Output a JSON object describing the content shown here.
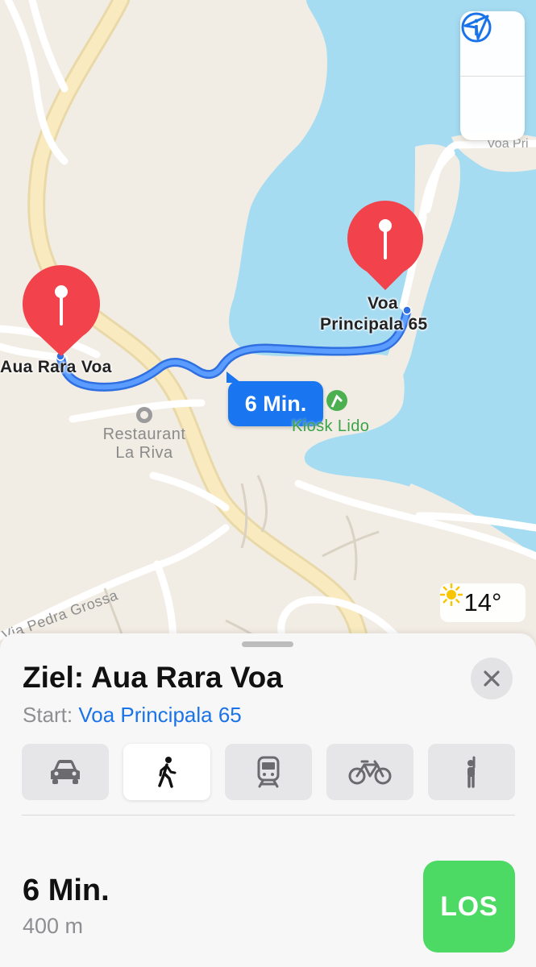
{
  "map": {
    "destination_label": "Aua Rara Voa",
    "start_label_line1": "Voa",
    "start_label_line2": "Principala 65",
    "route_duration": "6 Min.",
    "poi_restaurant_line1": "Restaurant",
    "poi_restaurant_line2": "La Riva",
    "poi_kiosk": "Kiosk Lido",
    "street_pedra_grossa": "Via Pedra Grossa",
    "street_voa_pri": "Voa Pri",
    "weather_temp": "14°",
    "colors": {
      "water": "#a6dcf2",
      "land": "#f2ede4",
      "route": "#3b82f6",
      "pin": "#f2424b",
      "main_road": "#f7e3a8"
    }
  },
  "controls": {
    "info_icon": "info-icon",
    "location_icon": "location-arrow-icon"
  },
  "sheet": {
    "title": "Ziel: Aua Rara Voa",
    "start_label": "Start:",
    "start_value": "Voa Principala 65",
    "modes": [
      {
        "name": "car",
        "icon": "car-icon",
        "active": false
      },
      {
        "name": "walk",
        "icon": "walking-icon",
        "active": true
      },
      {
        "name": "transit",
        "icon": "train-icon",
        "active": false
      },
      {
        "name": "bike",
        "icon": "bicycle-icon",
        "active": false
      },
      {
        "name": "ride",
        "icon": "hail-icon",
        "active": false
      }
    ],
    "duration": "6 Min.",
    "distance": "400 m",
    "go_label": "LOS"
  }
}
